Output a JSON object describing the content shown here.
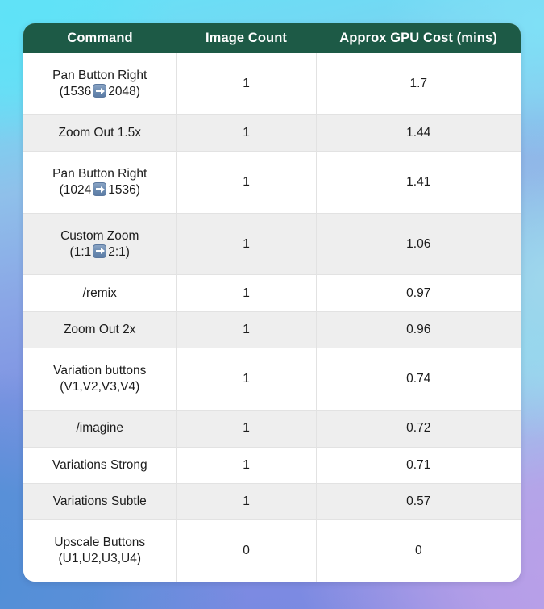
{
  "background": {
    "colors": [
      "#66e2f7",
      "#8fc0ea",
      "#7f93e2",
      "#4f8fd6",
      "#b59ae8"
    ]
  },
  "theme": {
    "header_bg": "#1d5a46",
    "header_text": "#ffffff",
    "row_alt_bg": "#eeeeee",
    "row_bg": "#ffffff",
    "border": "#e2e2e2",
    "text": "#1c1c1c",
    "arrow_icon_bg": "#6d8cb2"
  },
  "chart_data": {
    "type": "table",
    "title": "",
    "columns": [
      "Command",
      "Image Count",
      "Approx GPU Cost (mins)"
    ],
    "categories": [
      "Pan Button Right (1536 ➡ 2048)",
      "Zoom Out 1.5x",
      "Pan Button Right (1024 ➡ 1536)",
      "Custom Zoom (1:1 ➡ 2:1)",
      "/remix",
      "Zoom Out 2x",
      "Variation buttons (V1,V2,V3,V4)",
      "/imagine",
      "Variations Strong",
      "Variations Subtle",
      "Upscale Buttons (U1,U2,U3,U4)"
    ],
    "series": [
      {
        "name": "Image Count",
        "values": [
          1,
          1,
          1,
          1,
          1,
          1,
          1,
          1,
          1,
          1,
          0
        ]
      },
      {
        "name": "Approx GPU Cost (mins)",
        "values": [
          1.7,
          1.44,
          1.41,
          1.06,
          0.97,
          0.96,
          0.74,
          0.72,
          0.71,
          0.57,
          0
        ]
      }
    ],
    "xlabel": "Command",
    "ylabel": "Approx GPU Cost (mins)"
  },
  "table": {
    "headers": {
      "command": "Command",
      "image_count": "Image Count",
      "gpu_cost": "Approx GPU Cost (mins)"
    },
    "rows": [
      {
        "command_line1": "Pan Button Right",
        "command_prefix": "(1536",
        "command_suffix": "2048)",
        "has_arrow": true,
        "image_count": "1",
        "gpu_cost": "1.7"
      },
      {
        "command_line1": "Zoom Out 1.5x",
        "command_prefix": "",
        "command_suffix": "",
        "has_arrow": false,
        "image_count": "1",
        "gpu_cost": "1.44"
      },
      {
        "command_line1": "Pan Button Right",
        "command_prefix": "(1024",
        "command_suffix": "1536)",
        "has_arrow": true,
        "image_count": "1",
        "gpu_cost": "1.41"
      },
      {
        "command_line1": "Custom Zoom",
        "command_prefix": "(1:1",
        "command_suffix": "2:1)",
        "has_arrow": true,
        "image_count": "1",
        "gpu_cost": "1.06"
      },
      {
        "command_line1": "/remix",
        "command_prefix": "",
        "command_suffix": "",
        "has_arrow": false,
        "image_count": "1",
        "gpu_cost": "0.97"
      },
      {
        "command_line1": "Zoom Out 2x",
        "command_prefix": "",
        "command_suffix": "",
        "has_arrow": false,
        "image_count": "1",
        "gpu_cost": "0.96"
      },
      {
        "command_line1": "Variation buttons",
        "command_prefix": "(V1,V2,V3,V4)",
        "command_suffix": "",
        "has_arrow": false,
        "image_count": "1",
        "gpu_cost": "0.74"
      },
      {
        "command_line1": "/imagine",
        "command_prefix": "",
        "command_suffix": "",
        "has_arrow": false,
        "image_count": "1",
        "gpu_cost": "0.72"
      },
      {
        "command_line1": "Variations Strong",
        "command_prefix": "",
        "command_suffix": "",
        "has_arrow": false,
        "image_count": "1",
        "gpu_cost": "0.71"
      },
      {
        "command_line1": "Variations Subtle",
        "command_prefix": "",
        "command_suffix": "",
        "has_arrow": false,
        "image_count": "1",
        "gpu_cost": "0.57"
      },
      {
        "command_line1": "Upscale Buttons",
        "command_prefix": "(U1,U2,U3,U4)",
        "command_suffix": "",
        "has_arrow": false,
        "image_count": "0",
        "gpu_cost": "0"
      }
    ]
  }
}
